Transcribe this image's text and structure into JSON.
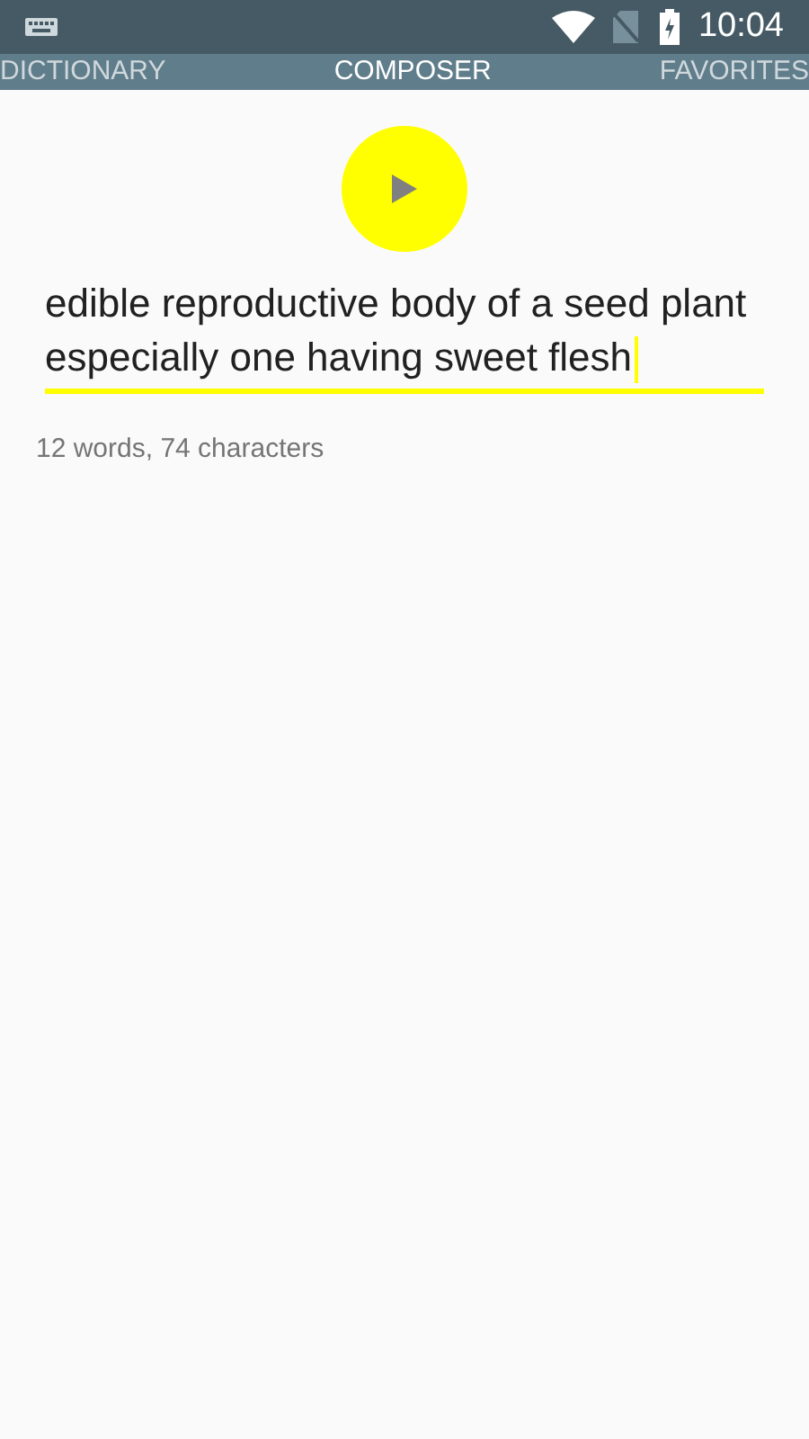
{
  "status_bar": {
    "time": "10:04"
  },
  "tabs": [
    {
      "label": "DICTIONARY",
      "selected": false
    },
    {
      "label": "COMPOSER",
      "selected": true
    },
    {
      "label": "FAVORITES",
      "selected": false
    }
  ],
  "composer": {
    "text": "edible reproductive body of a seed plant especially one having sweet flesh",
    "count": "12 words, 74 characters"
  }
}
